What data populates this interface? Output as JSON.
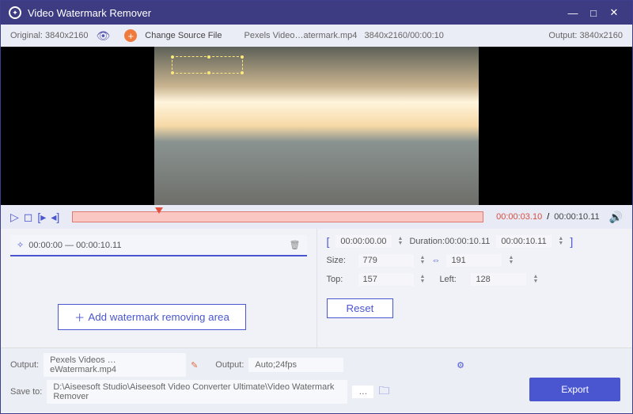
{
  "titlebar": {
    "title": "Video Watermark Remover"
  },
  "topbar": {
    "original_label": "Original:",
    "original_res": "3840x2160",
    "change_label": "Change Source File",
    "filename": "Pexels Video…atermark.mp4",
    "file_res": "3840x2160",
    "file_dur": "00:00:10",
    "output_label": "Output:",
    "output_res": "3840x2160"
  },
  "controls": {
    "time_cur": "00:00:03.10",
    "time_tot": "00:00:10.11"
  },
  "segment": {
    "watermark_range": "00:00:00 — 00:00:10.11"
  },
  "crop": {
    "start": "00:00:00.00",
    "dur_label": "Duration:",
    "dur": "00:00:10.11",
    "end": "00:00:10.11",
    "size_label": "Size:",
    "w": "779",
    "h": "191",
    "top_label": "Top:",
    "top": "157",
    "left_label": "Left:",
    "left": "128",
    "reset": "Reset"
  },
  "add_btn": "Add watermark removing area",
  "bottom": {
    "output_label": "Output:",
    "output_name": "Pexels Videos …eWatermark.mp4",
    "fmt_label": "Output:",
    "fmt": "Auto;24fps",
    "save_label": "Save to:",
    "save_path": "D:\\Aiseesoft Studio\\Aiseesoft Video Converter Ultimate\\Video Watermark Remover",
    "export": "Export"
  }
}
